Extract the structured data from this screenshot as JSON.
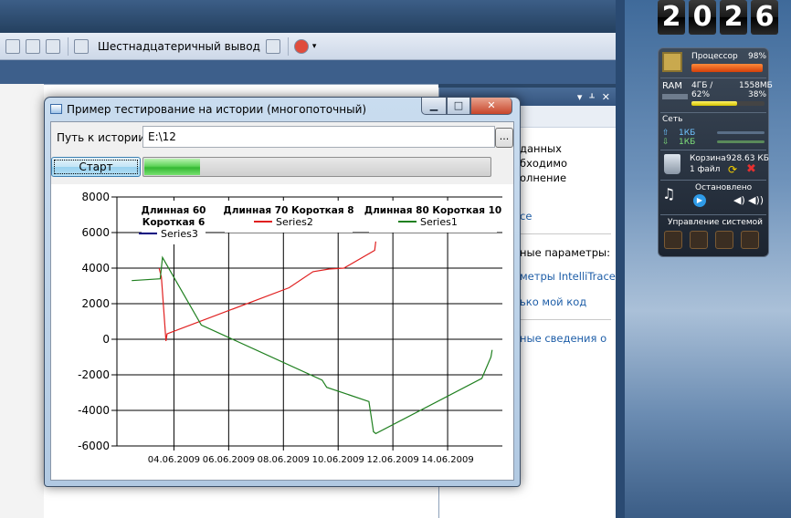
{
  "ide": {
    "toolbar": {
      "hex_output_label": "Шестнадцатеричный вывод"
    },
    "right_panel": {
      "lines": [
        "данных",
        "бходимо",
        "олнение",
        "се",
        "ные параметры:",
        "метры IntelliTrace",
        "ько мой код",
        "ные сведения о"
      ]
    }
  },
  "gadgets": {
    "clock": {
      "digits": [
        "2",
        "0",
        "2",
        "6"
      ]
    },
    "sysmon": {
      "cpu_label": "Процессор",
      "cpu_percent": 98,
      "cpu_percent_text": "98%",
      "ram_label": "RAM",
      "ram_total": "4ГБ /",
      "ram_used": "1558МБ",
      "ram_percent_left": "62%",
      "ram_percent_right": "38%",
      "ram_fraction": 0.62,
      "net_label": "Сеть",
      "net_up": "1КБ",
      "net_down": "1КБ",
      "recycle_label": "Корзина",
      "recycle_size": "928.63 КБ",
      "recycle_files": "1 файл",
      "player_status": "Остановлено",
      "system_control": "Управление системой"
    }
  },
  "window": {
    "title": "Пример тестирование на истории (многопоточный)",
    "path_label": "Путь к истории:",
    "path_value": "E:\\12",
    "browse_label": "...",
    "start_label": "Старт",
    "progress_fraction": 0.16,
    "min_glyph": "▁",
    "max_glyph": "□",
    "close_glyph": "✕"
  },
  "chart_data": {
    "type": "line",
    "y_ticks": [
      "8000",
      "6000",
      "4000",
      "2000",
      "0",
      "-2000",
      "-4000",
      "-6000"
    ],
    "ylim": [
      -6000,
      8000
    ],
    "x_ticks": [
      "04.06.2009",
      "06.06.2009",
      "08.06.2009",
      "10.06.2009",
      "12.06.2009",
      "14.06.2009"
    ],
    "xlim": [
      "2009-06-02T10:00",
      "2009-06-16T12:00"
    ],
    "grid": true,
    "legend": [
      {
        "title_lines": [
          "Длинная 60",
          "Короткая 6"
        ],
        "name": "Series3",
        "color": "#000080"
      },
      {
        "title_lines": [
          "Длинная 70 Короткая 8"
        ],
        "name": "Series2",
        "color": "#e02020"
      },
      {
        "title_lines": [
          "Длинная 80 Короткая 10"
        ],
        "name": "Series1",
        "color": "#208020"
      }
    ],
    "series": [
      {
        "name": "Series2",
        "color": "#e02020",
        "points": [
          [
            "2009-06-03T23:00",
            4000
          ],
          [
            "2009-06-04T01:00",
            3500
          ],
          [
            "2009-06-04T05:00",
            -100
          ],
          [
            "2009-06-04T06:00",
            300
          ],
          [
            "2009-06-08T17:00",
            2900
          ],
          [
            "2009-06-09T14:00",
            3800
          ],
          [
            "2009-06-10T04:00",
            3950
          ],
          [
            "2009-06-10T17:00",
            4000
          ],
          [
            "2009-06-11T20:00",
            5000
          ],
          [
            "2009-06-11T21:00",
            5500
          ]
        ]
      },
      {
        "name": "Series1",
        "color": "#208020",
        "points": [
          [
            "2009-06-02T23:00",
            3300
          ],
          [
            "2009-06-04T00:00",
            3400
          ],
          [
            "2009-06-04T02:00",
            4600
          ],
          [
            "2009-06-05T12:00",
            800
          ],
          [
            "2009-06-09T22:00",
            -2300
          ],
          [
            "2009-06-10T02:00",
            -2700
          ],
          [
            "2009-06-11T15:00",
            -3500
          ],
          [
            "2009-06-11T19:00",
            -5200
          ],
          [
            "2009-06-11T21:00",
            -5300
          ],
          [
            "2009-06-15T18:00",
            -2200
          ],
          [
            "2009-06-16T02:00",
            -1000
          ],
          [
            "2009-06-16T03:00",
            -600
          ]
        ]
      }
    ]
  }
}
